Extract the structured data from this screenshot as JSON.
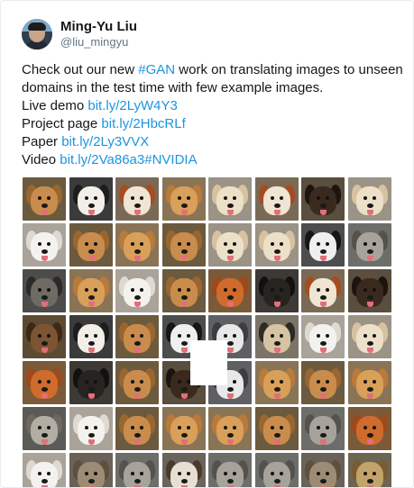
{
  "author": {
    "display_name": "Ming-Yu Liu",
    "handle": "@liu_mingyu"
  },
  "tweet": {
    "line1_before": "Check out our new ",
    "hashtag": "#GAN",
    "line1_after": " work on translating images to unseen",
    "line2": "domains in the test time with few example images.",
    "demo_label": "Live demo ",
    "demo_link": "bit.ly/2LyW4Y3",
    "project_label": "Project page ",
    "project_link": "bit.ly/2HbcRLf",
    "paper_label": "Paper ",
    "paper_link": "bit.ly/2Ly3VVX",
    "video_label": "Video ",
    "video_link": "bit.ly/2Va86a3",
    "video_hashtag": "#NVIDIA"
  },
  "colors": {
    "link": "#1b95e0",
    "text": "#14171a",
    "muted": "#657786"
  },
  "image_grid": {
    "rows": 7,
    "cols": 8,
    "cells": [
      [
        "tan",
        "tricolor",
        "redwhite",
        "golden",
        "cream",
        "redwhite",
        "blacktan",
        "cream"
      ],
      [
        "white",
        "tan",
        "golden",
        "tan",
        "cream",
        "cream",
        "blackwhite",
        "grey"
      ],
      [
        "greyblack",
        "golden",
        "white",
        "tan",
        "red",
        "black",
        "redwhite",
        "blacktan"
      ],
      [
        "brindle",
        "tricolor",
        "tan",
        "blackwhite",
        "husky",
        "fawn",
        "white",
        "cream"
      ],
      [
        "red",
        "black",
        "tan",
        "blacktan",
        "husky",
        "golden",
        "tan",
        "golden"
      ],
      [
        "wolfgrey",
        "white",
        "tan",
        "golden",
        "golden",
        "tan",
        "grey",
        "red"
      ],
      [
        "white",
        "tabby",
        "grey",
        "siamese",
        "grey",
        "grey",
        "tabby",
        "leopard"
      ]
    ]
  }
}
